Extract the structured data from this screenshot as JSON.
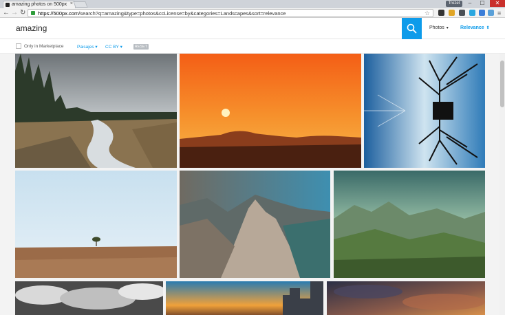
{
  "browser": {
    "tab_title": "amazing photos on 500px",
    "user_badge": "Trozet",
    "url_host": "https://500px.com",
    "url_path": "/search?q=amazing&type=photos&ccLicense=by&categories=Landscapes&sort=relevance",
    "window_controls": {
      "minimize": "–",
      "maximize": "☐",
      "close": "✕"
    }
  },
  "header": {
    "search_query": "amazing",
    "type_dropdown": "Photos",
    "sort_dropdown": "Relevance"
  },
  "filters": {
    "only_marketplace": "Only in Marketplace",
    "category": "Paisajes",
    "license": "CC BY",
    "reset": "RESET"
  },
  "photos": [
    {
      "name": "misty-river-forest"
    },
    {
      "name": "orange-sunset-mountains"
    },
    {
      "name": "tree-reflection"
    },
    {
      "name": "lone-tree-field"
    },
    {
      "name": "rocky-mountain-peak"
    },
    {
      "name": "green-valley-clouds"
    },
    {
      "name": "dramatic-clouds-bw"
    },
    {
      "name": "city-sunset"
    },
    {
      "name": "stormy-sunset-sky"
    }
  ],
  "colors": {
    "accent": "#0d9bea"
  }
}
